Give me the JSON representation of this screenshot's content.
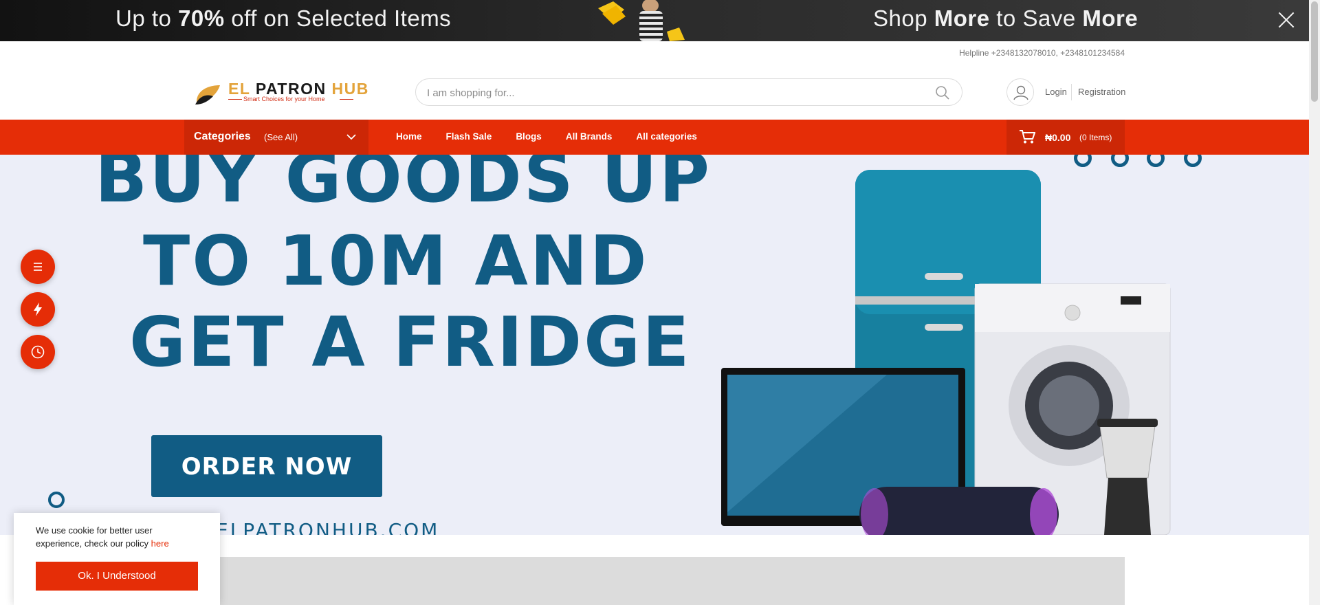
{
  "promo": {
    "left_prefix": "Up to ",
    "left_bold": "70%",
    "left_suffix": " off on Selected Items",
    "right_pre": "Shop ",
    "right_bold1": "More",
    "right_mid": " to Save ",
    "right_bold2": "More",
    "close_icon": "close-icon"
  },
  "header": {
    "helpline": "Helpline +2348132078010, +2348101234584",
    "logo": {
      "el": "EL ",
      "patron": "PATRON ",
      "hub": "HUB",
      "tagline": "Smart Choices for your Home"
    },
    "search": {
      "placeholder": "I am shopping for...",
      "icon": "search-icon"
    },
    "account": {
      "icon": "user-icon",
      "login": "Login",
      "register": "Registration"
    }
  },
  "nav": {
    "categories_label": "Categories",
    "see_all": "(See All)",
    "links": [
      "Home",
      "Flash Sale",
      "Blogs",
      "All Brands",
      "All categories"
    ],
    "cart": {
      "amount": "₦0.00",
      "items": "(0 Items)",
      "icon": "cart-icon"
    }
  },
  "hero": {
    "line1": "BUY GOODS UP",
    "line2": "TO 10M AND",
    "line3": "GET A FRIDGE",
    "button": "ORDER NOW",
    "url": "ELPATRONHUB.COM"
  },
  "side_buttons": [
    "menu-icon",
    "flash-icon",
    "clock-icon"
  ],
  "cookie": {
    "text": "We use cookie for better user experience, check our policy ",
    "link": "here",
    "button": "Ok. I Understood"
  },
  "colors": {
    "brand_red": "#e52d07",
    "hero_blue": "#115c84",
    "hero_bg": "#eceef8",
    "logo_gold": "#e3a33a"
  }
}
